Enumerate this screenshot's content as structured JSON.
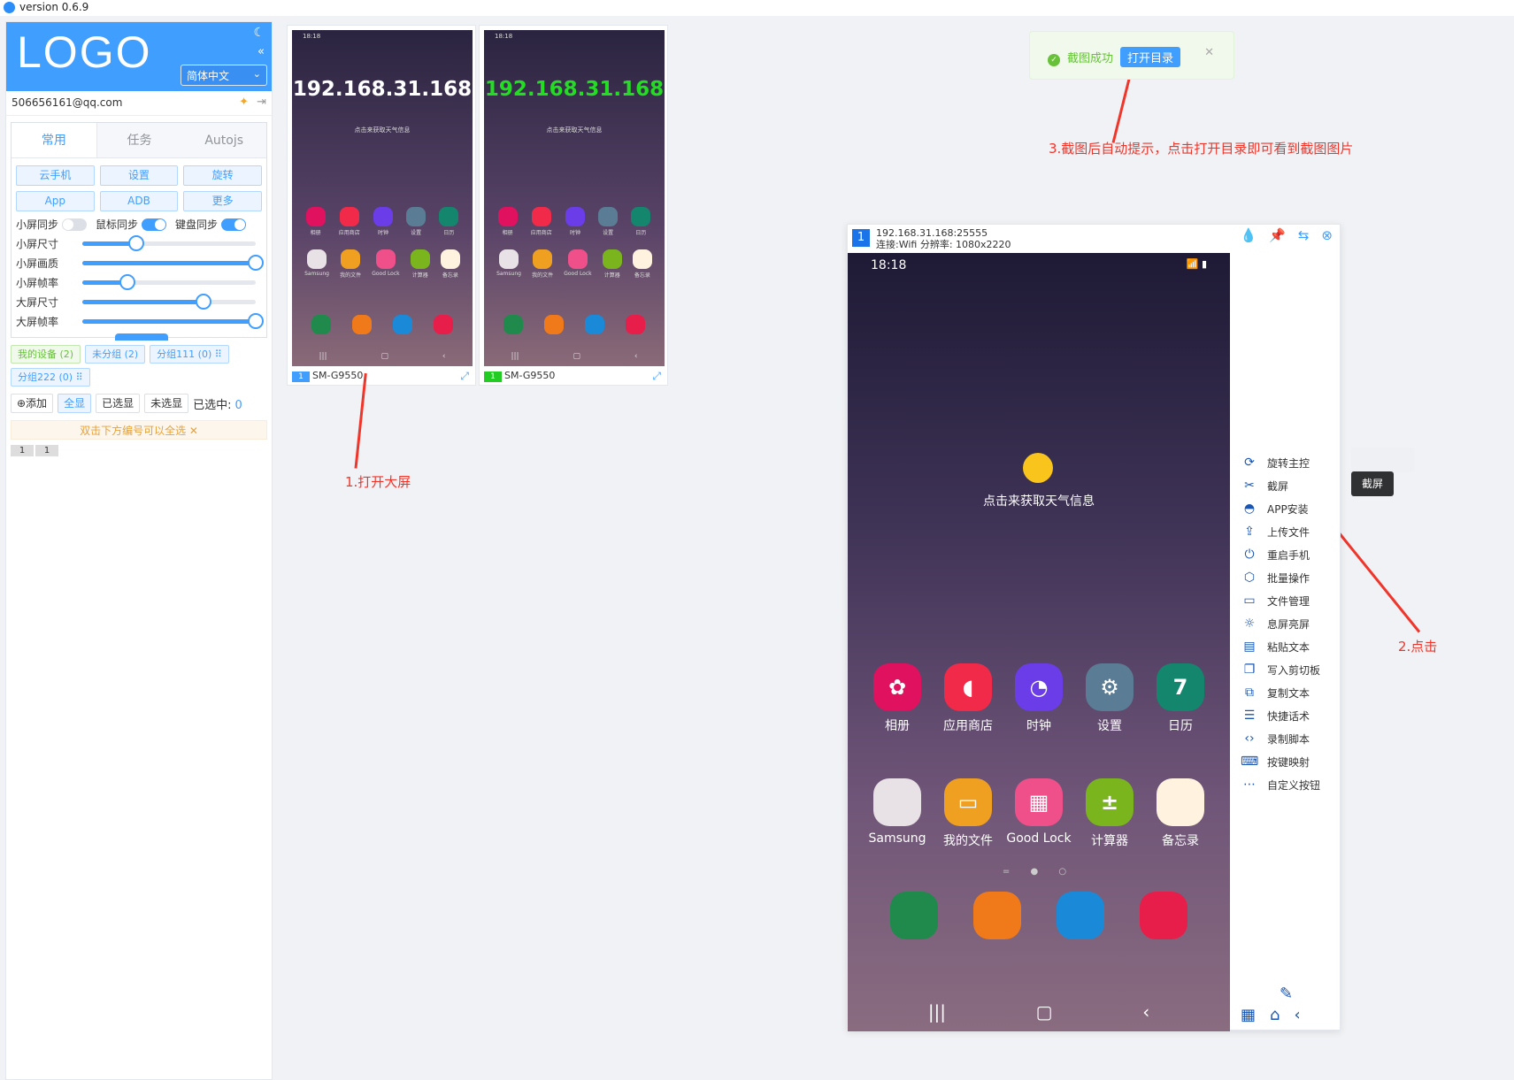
{
  "titlebar": {
    "version": "version 0.6.9"
  },
  "sidebar": {
    "logo": "LOGO",
    "language": "简体中文",
    "account": "506656161@qq.com",
    "tabs": [
      "常用",
      "任务",
      "Autojs"
    ],
    "buttons": [
      "云手机",
      "设置",
      "旋转",
      "App",
      "ADB",
      "更多"
    ],
    "sync": [
      {
        "label": "小屏同步",
        "on": false
      },
      {
        "label": "鼠标同步",
        "on": true
      },
      {
        "label": "键盘同步",
        "on": true
      }
    ],
    "sliders": [
      {
        "label": "小屏尺寸",
        "value": 0.31
      },
      {
        "label": "小屏画质",
        "value": 1.0
      },
      {
        "label": "小屏帧率",
        "value": 0.26
      },
      {
        "label": "大屏尺寸",
        "value": 0.7
      },
      {
        "label": "大屏帧率",
        "value": 1.0
      }
    ],
    "groups": [
      "我的设备 (2)",
      "未分组 (2)",
      "分组111 (0) ⠿",
      "分组222 (0) ⠿"
    ],
    "select_buttons": [
      "⊕添加",
      "全显",
      "已选显",
      "未选显"
    ],
    "selected_label": "已选中:",
    "selected_count": "0",
    "hint": "双击下方编号可以全选 ✕",
    "mini_ids": [
      "1",
      "1"
    ]
  },
  "cards": [
    {
      "ip": "192.168.31.168",
      "model": "SM-G9550",
      "num": "1",
      "badge_color": "#409eff",
      "ip_color": "#ffffff"
    },
    {
      "ip": "192.168.31.168",
      "model": "SM-G9550",
      "num": "1",
      "badge_color": "#22cc22",
      "ip_color": "#22dd22"
    }
  ],
  "phone_small": {
    "time": "18:18",
    "weather": "点击来获取天气信息",
    "row1": [
      "相册",
      "应用商店",
      "时钟",
      "设置",
      "日历"
    ],
    "row2": [
      "Samsung",
      "我的文件",
      "Good Lock",
      "计算器",
      "备忘录"
    ]
  },
  "annotations": {
    "a1": "1.打开大屏",
    "a2": "2.点击",
    "a3": "3.截图后自动提示，点击打开目录即可看到截图图片"
  },
  "toast": {
    "message": "截图成功",
    "button": "打开目录"
  },
  "bigwin": {
    "num": "1",
    "address": "192.168.31.168:25555",
    "conn": "连接:Wifi 分辨率: 1080x2220",
    "time": "18:18",
    "weather": "点击来获取天气信息",
    "row1": [
      "相册",
      "应用商店",
      "时钟",
      "设置",
      "日历"
    ],
    "row2": [
      "Samsung",
      "我的文件",
      "Good Lock",
      "计算器",
      "备忘录"
    ],
    "calendar_day": "7",
    "tools": [
      {
        "label": "旋转主控",
        "icon": "rotate-icon",
        "glyph": "⟳"
      },
      {
        "label": "截屏",
        "icon": "screenshot-icon",
        "glyph": "✂"
      },
      {
        "label": "APP安装",
        "icon": "android-icon",
        "glyph": "◓"
      },
      {
        "label": "上传文件",
        "icon": "upload-icon",
        "glyph": "⇪"
      },
      {
        "label": "重启手机",
        "icon": "power-icon",
        "glyph": "⏻"
      },
      {
        "label": "批量操作",
        "icon": "cube-icon",
        "glyph": "⬡"
      },
      {
        "label": "文件管理",
        "icon": "folder-icon",
        "glyph": "▭"
      },
      {
        "label": "息屏亮屏",
        "icon": "brightness-icon",
        "glyph": "☼"
      },
      {
        "label": "粘贴文本",
        "icon": "paste-icon",
        "glyph": "▤"
      },
      {
        "label": "写入剪切板",
        "icon": "clipboard-icon",
        "glyph": "❐"
      },
      {
        "label": "复制文本",
        "icon": "copy-icon",
        "glyph": "⧉"
      },
      {
        "label": "快捷话术",
        "icon": "chat-icon",
        "glyph": "☰"
      },
      {
        "label": "录制脚本",
        "icon": "code-icon",
        "glyph": "‹›"
      },
      {
        "label": "按键映射",
        "icon": "gamepad-icon",
        "glyph": "⌨"
      },
      {
        "label": "自定义按钮",
        "icon": "more-icon",
        "glyph": "⋯"
      }
    ],
    "tooltip": "截屏"
  }
}
